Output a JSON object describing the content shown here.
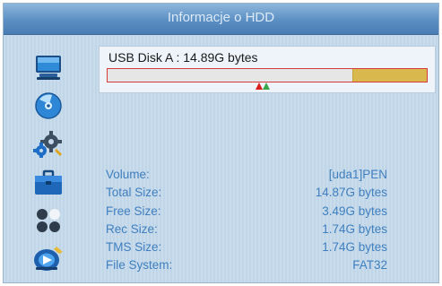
{
  "header": {
    "title": "Informacje o HDD"
  },
  "sidebar": {
    "items": [
      {
        "icon": "monitor-icon"
      },
      {
        "icon": "disc-icon"
      },
      {
        "icon": "settings-gear-icon"
      },
      {
        "icon": "toolbox-icon"
      },
      {
        "icon": "dots-icon"
      },
      {
        "icon": "media-playback-icon"
      }
    ]
  },
  "disk": {
    "label": "USB Disk A : 14.89G bytes",
    "used_fraction": 0.23,
    "colors": {
      "bar_border": "#d63a3a",
      "used_fill": "#d9b94e",
      "free_fill": "#e6e6e6",
      "marker_red": "#d81e1e",
      "marker_green": "#3aa64a"
    }
  },
  "details": {
    "rows": [
      {
        "label": "Volume:",
        "value": "[uda1]PEN"
      },
      {
        "label": "Total Size:",
        "value": "14.87G bytes"
      },
      {
        "label": "Free Size:",
        "value": "3.49G bytes"
      },
      {
        "label": "Rec Size:",
        "value": "1.74G bytes"
      },
      {
        "label": "TMS Size:",
        "value": "1.74G bytes"
      },
      {
        "label": "File System:",
        "value": "FAT32"
      }
    ]
  }
}
